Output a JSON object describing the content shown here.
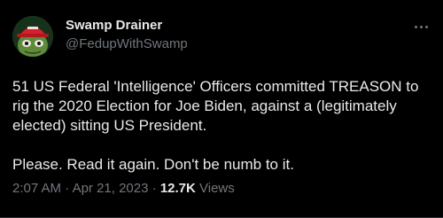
{
  "author": {
    "display_name": "Swamp Drainer",
    "handle": "@FedupWithSwamp",
    "avatar_icon": "frog-with-red-cap-avatar"
  },
  "tweet": {
    "paragraph_1": "51 US Federal 'Intelligence' Officers committed TREASON to rig the 2020 Election for Joe Biden, against a (legitimately elected) sitting US President.",
    "paragraph_2": "Please. Read it again. Don't be numb to it."
  },
  "meta": {
    "time": "2:07 AM",
    "separator": " · ",
    "date": "Apr 21, 2023",
    "views_count": "12.7K",
    "views_label": " Views"
  },
  "colors": {
    "background": "#000000",
    "text_primary": "#e7e9ea",
    "text_secondary": "#71767b",
    "cap_red": "#d6202c"
  }
}
